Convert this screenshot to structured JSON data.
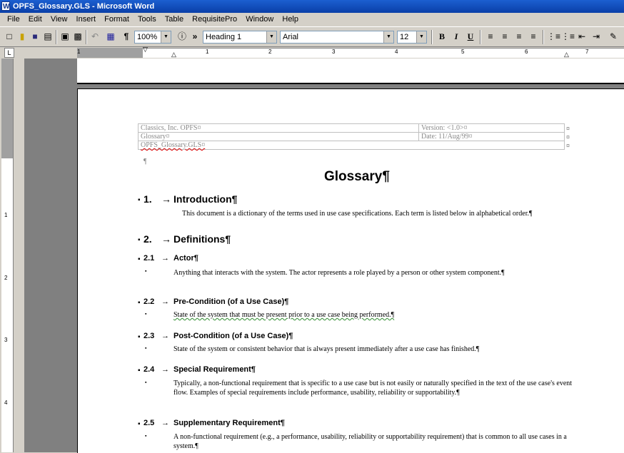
{
  "titlebar": {
    "title": "OPFS_Glossary.GLS - Microsoft Word"
  },
  "menu": [
    "File",
    "Edit",
    "View",
    "Insert",
    "Format",
    "Tools",
    "Table",
    "RequisitePro",
    "Window",
    "Help"
  ],
  "toolbar": {
    "zoom": "100%",
    "style": "Heading 1",
    "font": "Arial",
    "size": "12",
    "icons": [
      "new-icon",
      "open-icon",
      "save-icon",
      "print-icon",
      "print-preview-icon",
      "paste-icon",
      "undo-icon",
      "table-icon",
      "show-formatting-icon",
      "help-icon",
      "bold-icon",
      "italic-icon",
      "underline-icon",
      "align-left-icon",
      "center-icon",
      "align-right-icon",
      "justify-icon",
      "numbering-icon",
      "bullets-icon",
      "decrease-indent-icon",
      "increase-indent-icon",
      "highlight-icon"
    ],
    "bold": "B",
    "italic": "I",
    "underline": "U",
    "para_mark": "¶",
    "more": "»"
  },
  "ruler": {
    "numbers": [
      "1",
      "1",
      "2",
      "3",
      "4",
      "5",
      "6",
      "7"
    ],
    "corner": "L",
    "vnumbers": [
      "1",
      "2",
      "3",
      "4"
    ]
  },
  "header": {
    "rows": [
      [
        "Classics, Inc. OPFS¤",
        "Version:           <1.0>¤"
      ],
      [
        "Glossary¤",
        "Date:  11/Aug/99¤"
      ],
      [
        "OPFS_Glossary.GLS¤",
        ""
      ]
    ],
    "cell_end": "¤"
  },
  "doc": {
    "pilcrow": "¶",
    "title": "Glossary¶",
    "sections": [
      {
        "num": "1.",
        "title": "Introduction¶",
        "level": 1,
        "text": "This document is a dictionary of the terms used in use case specifications.  Each term is listed below in alphabetical order.¶"
      },
      {
        "num": "2.",
        "title": "Definitions¶",
        "level": 1,
        "text": ""
      },
      {
        "num": "2.1",
        "title": "Actor¶",
        "level": 2,
        "text": "Anything that interacts with the system.  The actor represents a role played by a person or other system component.¶"
      },
      {
        "num": "2.2",
        "title": "Pre-Condition (of a Use Case)¶",
        "level": 2,
        "text": "State of the system that must be present prior to a use case being performed.¶"
      },
      {
        "num": "2.3",
        "title": "Post-Condition (of a Use Case)¶",
        "level": 2,
        "text": "State of the system or consistent behavior that is always present immediately after a use case has finished.¶"
      },
      {
        "num": "2.4",
        "title": "Special Requirement¶",
        "level": 2,
        "text": "Typically, a non-functional requirement that is specific to a use case but is not easily or naturally specified in the text of the use case's event flow.  Examples of special requirements include performance, usability, reliability or supportability.¶"
      },
      {
        "num": "2.5",
        "title": "Supplementary Requirement¶",
        "level": 2,
        "text": "A non-functional requirement (e.g., a performance, usability, reliability or supportability requirement) that is common to all use cases in a system.¶"
      }
    ],
    "arrow": "→",
    "bullet": "▪"
  }
}
